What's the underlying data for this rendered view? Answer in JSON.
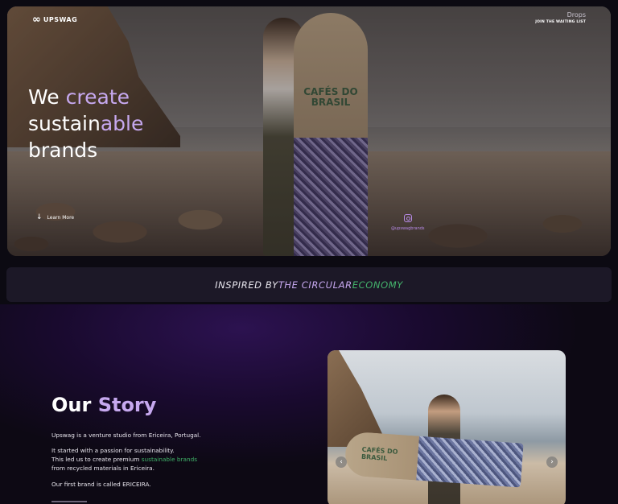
{
  "header": {
    "logo_symbol": "∞",
    "logo_text": "UPSWAG",
    "nav_drops": "Drops",
    "nav_waiting": "JOIN THE WAITING LIST"
  },
  "hero": {
    "line1_a": "We ",
    "line1_b": "create",
    "line2_a": "sustain",
    "line2_b": "able",
    "line3": "brands",
    "board_text": "CAFÉS DO BRASIL",
    "learn_more": "Learn More",
    "instagram_handle": "@upswagbrands"
  },
  "banner": {
    "part1": "INSPIRED BY ",
    "part2": "THE CIRCULAR ",
    "part3": "ECONOMY"
  },
  "story": {
    "title_a": "Our ",
    "title_b": "Story",
    "p1": "Upswag is a venture studio from Ericeira, Portugal.",
    "p2_line1": "It started with a passion for sustainability.",
    "p2_line2_a": "This led us to create premium ",
    "p2_line2_b": "sustainable brands",
    "p2_line3": "from recycled materials in Ericeira.",
    "p3": "Our first brand is called ERICEIRA.",
    "photo_board_text": "CAFÉS DO BRASIL",
    "prev_symbol": "‹",
    "next_symbol": "›"
  },
  "colors": {
    "accent_lavender": "#c6a8ef",
    "accent_green": "#3fb068",
    "banner_bg": "#1c1827",
    "page_bg": "#0c0a12"
  }
}
